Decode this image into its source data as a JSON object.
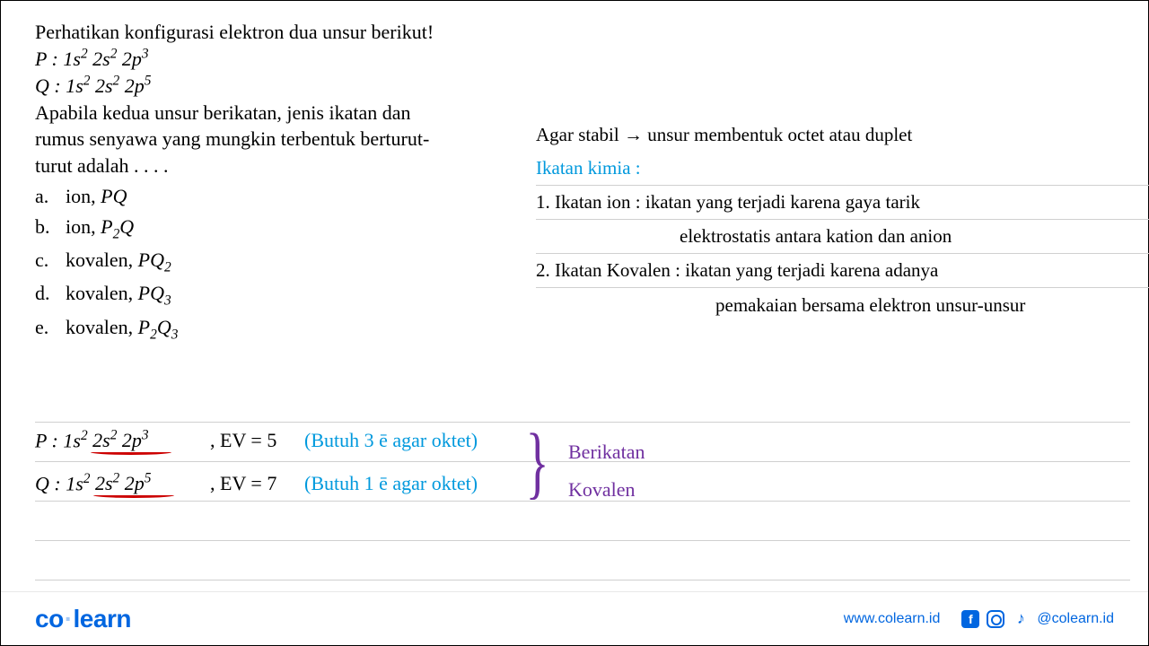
{
  "question": {
    "intro": "Perhatikan konfigurasi elektron dua unsur berikut!",
    "configP_label": "P",
    "configP_value_html": "1s² 2s² 2p³",
    "configQ_label": "Q",
    "configQ_value_html": "1s² 2s² 2p⁵",
    "stem1": "Apabila kedua unsur berikatan, jenis ikatan dan",
    "stem2": "rumus senyawa yang mungkin terbentuk berturut-",
    "stem3": "turut adalah . . . ."
  },
  "options": {
    "a": {
      "letter": "a.",
      "prefix": "ion, ",
      "formula": "PQ"
    },
    "b": {
      "letter": "b.",
      "prefix": "ion, ",
      "formula": "P₂Q"
    },
    "c": {
      "letter": "c.",
      "prefix": "kovalen, ",
      "formula": "PQ₂"
    },
    "d": {
      "letter": "d.",
      "prefix": "kovalen, ",
      "formula": "PQ₃"
    },
    "e": {
      "letter": "e.",
      "prefix": "kovalen, ",
      "formula": "P₂Q₃"
    }
  },
  "notes": {
    "stable": "Agar stabil → unsur membentuk octet atau duplet",
    "heading": "Ikatan kimia :",
    "ion1": "1.  Ikatan ion : ikatan yang terjadi karena gaya tarik",
    "ion2": "elektrostatis antara kation dan anion",
    "kov1": "2. Ikatan Kovalen : ikatan yang terjadi karena adanya",
    "kov2": "pemakaian bersama elektron unsur-unsur"
  },
  "work": {
    "p_config": "P : 1s² 2s² 2p³",
    "p_ev": ", EV = 5",
    "p_need": "(Butuh 3 ē agar oktet)",
    "q_config": "Q : 1s² 2s² 2p⁵",
    "q_ev": ", EV = 7",
    "q_need": "(Butuh 1 ē agar oktet)"
  },
  "conclusion": {
    "line1": "Berikatan",
    "line2": "Kovalen"
  },
  "footer": {
    "logo1": "co",
    "logo2": "learn",
    "url": "www.colearn.id",
    "handle": "@colearn.id"
  }
}
